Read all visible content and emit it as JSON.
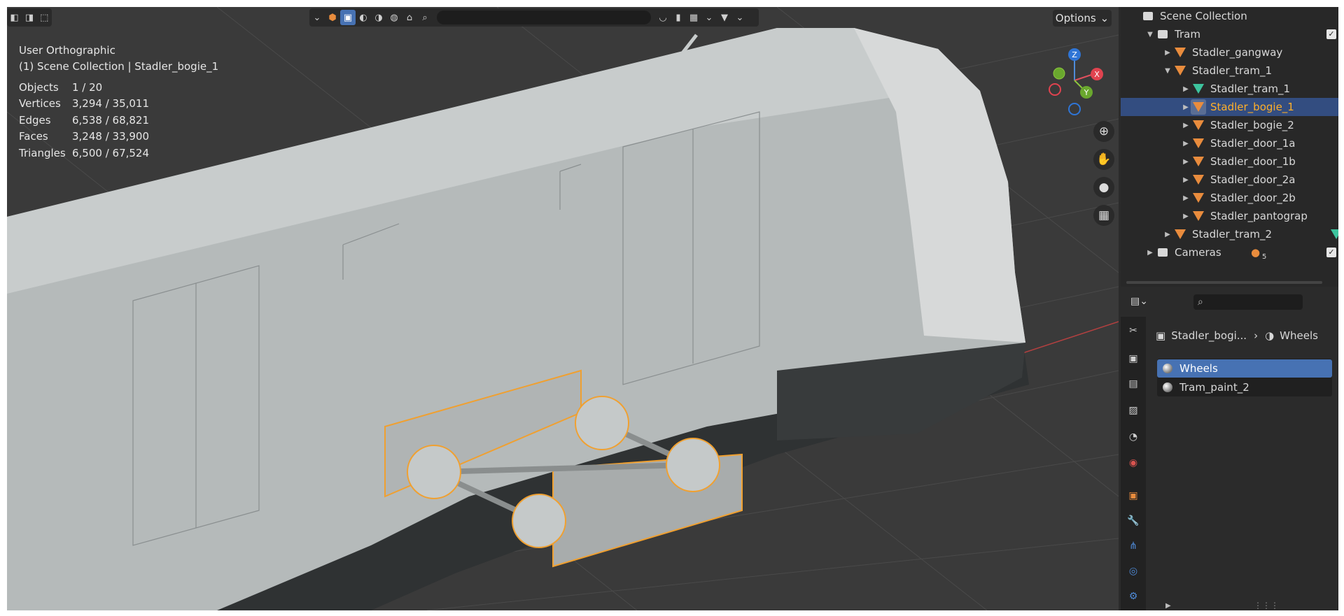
{
  "viewport": {
    "view_name": "User Orthographic",
    "context": "(1) Scene Collection | Stadler_bogie_1",
    "stats": [
      {
        "label": "Objects",
        "value": "1 / 20"
      },
      {
        "label": "Vertices",
        "value": "3,294 / 35,011"
      },
      {
        "label": "Edges",
        "value": "6,538 / 68,821"
      },
      {
        "label": "Faces",
        "value": "3,248 / 33,900"
      },
      {
        "label": "Triangles",
        "value": "6,500 / 67,524"
      }
    ],
    "options_label": "Options",
    "gizmo": {
      "z": "Z",
      "x": "X",
      "y": "Y"
    }
  },
  "outliner": {
    "items": [
      {
        "label": "Scene Collection"
      },
      {
        "label": "Tram"
      },
      {
        "label": "Stadler_gangway"
      },
      {
        "label": "Stadler_tram_1"
      },
      {
        "label": "Stadler_tram_1"
      },
      {
        "label": "Stadler_bogie_1"
      },
      {
        "label": "Stadler_bogie_2"
      },
      {
        "label": "Stadler_door_1a"
      },
      {
        "label": "Stadler_door_1b"
      },
      {
        "label": "Stadler_door_2a"
      },
      {
        "label": "Stadler_door_2b"
      },
      {
        "label": "Stadler_pantograp"
      },
      {
        "label": "Stadler_tram_2"
      },
      {
        "label": "Cameras"
      }
    ],
    "camera_count": "5"
  },
  "properties": {
    "breadcrumb_object": "Stadler_bogi...",
    "breadcrumb_material": "Wheels",
    "materials": [
      "Wheels",
      "Tram_paint_2"
    ]
  },
  "colors": {
    "accent": "#4772b3",
    "active_object": "#ffaf29",
    "selection_outline": "#f0a030"
  }
}
